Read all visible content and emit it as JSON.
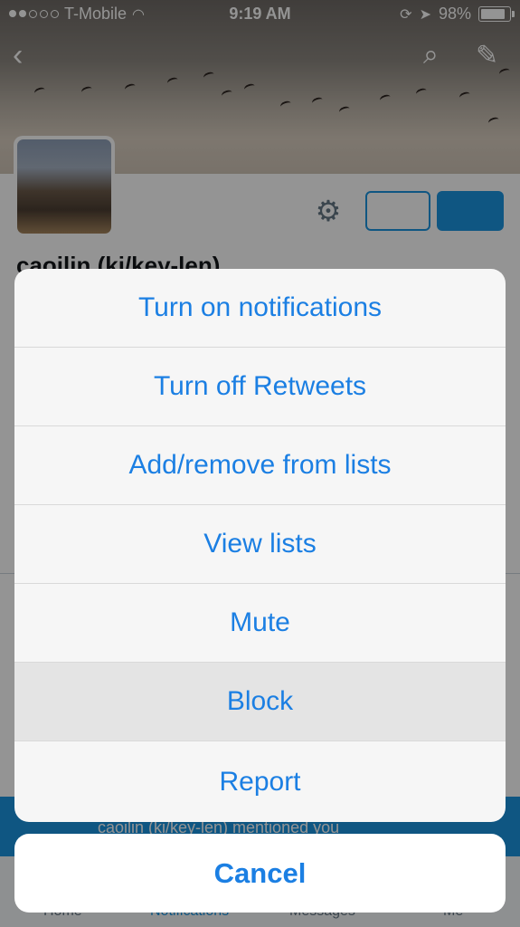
{
  "status_bar": {
    "carrier": "T-Mobile",
    "time": "9:19 AM",
    "battery": "98%",
    "battery_level": 0.98,
    "signal_bars": 2
  },
  "profile": {
    "display_name": "caoilin (ki/key-len)"
  },
  "notification_banner": {
    "text": "caoilin (ki/key-len) mentioned you"
  },
  "tab_bar": {
    "tabs": [
      "Home",
      "Notifications",
      "Messages",
      "Me"
    ],
    "active_tab": "Notifications"
  },
  "action_sheet": {
    "items": [
      {
        "label": "Turn on notifications",
        "highlighted": false
      },
      {
        "label": "Turn off Retweets",
        "highlighted": false
      },
      {
        "label": "Add/remove from lists",
        "highlighted": false
      },
      {
        "label": "View lists",
        "highlighted": false
      },
      {
        "label": "Mute",
        "highlighted": false
      },
      {
        "label": "Block",
        "highlighted": true
      },
      {
        "label": "Report",
        "highlighted": false
      }
    ],
    "cancel_label": "Cancel"
  },
  "colors": {
    "accent": "#1b7fe3",
    "twitter_blue": "#1b95e0"
  }
}
